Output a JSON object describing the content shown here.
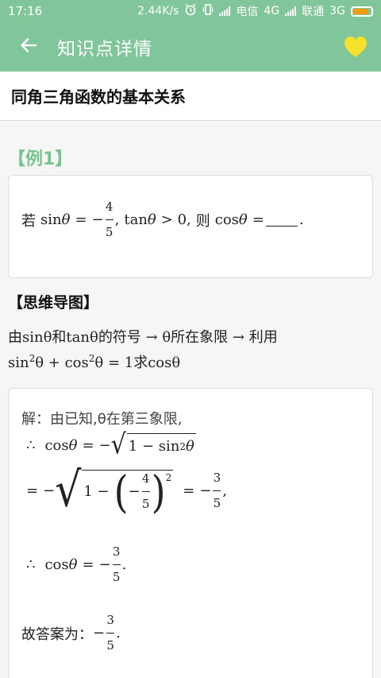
{
  "status_bar": {
    "time": "17:16",
    "speed": "2.44K/s",
    "carrier1": "电信",
    "net1": "4G",
    "carrier2": "联通",
    "net2": "3G",
    "battery_level": 0.85,
    "battery_color": "#f39c12"
  },
  "app_bar": {
    "title": "知识点详情",
    "back_icon": "arrow-left-icon",
    "favorite_icon": "heart-icon",
    "favorite_color": "#f5e12b",
    "background": "#80c69a"
  },
  "topic": {
    "title": "同角三角函数的基本关系"
  },
  "example": {
    "title": "【例1】",
    "q_prefix": "若",
    "q_sin": "sin",
    "theta": "θ",
    "eq": "=",
    "minus": "−",
    "frac_num": "4",
    "frac_den": "5",
    "comma": ",",
    "q_tan": "tan",
    "gt0": "> 0,",
    "q_then": "则",
    "q_cos": "cos",
    "period": "."
  },
  "mind_map": {
    "title": "【思维导图】",
    "line1": "由sinθ和tanθ的符号 → θ所在象限 → 利用",
    "line2_a": "sin",
    "line2_b": "θ + cos",
    "line2_c": "θ = 1求cosθ",
    "sq": "2"
  },
  "solution": {
    "line1": "解：由已知,θ在第三象限,",
    "therefore": "∴",
    "cos": "cos",
    "theta": "θ",
    "eq": "=",
    "minus": "−",
    "one_minus": "1 − sin",
    "sq": "2",
    "one": "1 −",
    "inner_num": "4",
    "inner_den": "5",
    "res_num": "3",
    "res_den": "5",
    "comma": ",",
    "period": ".",
    "answer_label": "故答案为："
  }
}
